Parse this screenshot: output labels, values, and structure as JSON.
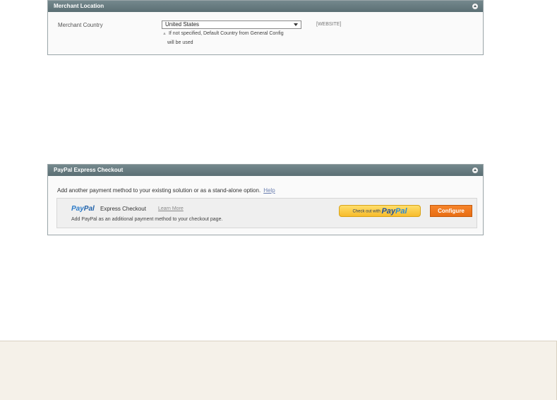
{
  "merchant_location": {
    "title": "Merchant Location",
    "country_label": "Merchant Country",
    "country_value": "United States",
    "note_line1": "If not specified, Default Country from General Config",
    "note_line2": "will be used",
    "scope": "[WEBSITE]"
  },
  "paypal_express": {
    "title": "PayPal Express Checkout",
    "intro": "Add another payment method to your existing solution or as a stand-alone option.",
    "help_link": "Help",
    "logo_pay": "Pay",
    "logo_pal": "Pal",
    "product_title": "Express Checkout",
    "learn_more": "Learn More",
    "description": "Add PayPal as an additional payment method to your checkout page.",
    "checkout_button_prefix": "Check out with",
    "checkout_button_pay": "Pay",
    "checkout_button_pal": "Pal",
    "configure_button": "Configure"
  },
  "icons": {
    "collapse": "collapse-up-icon",
    "dropdown": "chevron-down-icon",
    "note": "triangle-up-icon"
  },
  "colors": {
    "header": "#5f7378",
    "configure": "#f07a1c",
    "paypal_button": "#ffc439"
  }
}
